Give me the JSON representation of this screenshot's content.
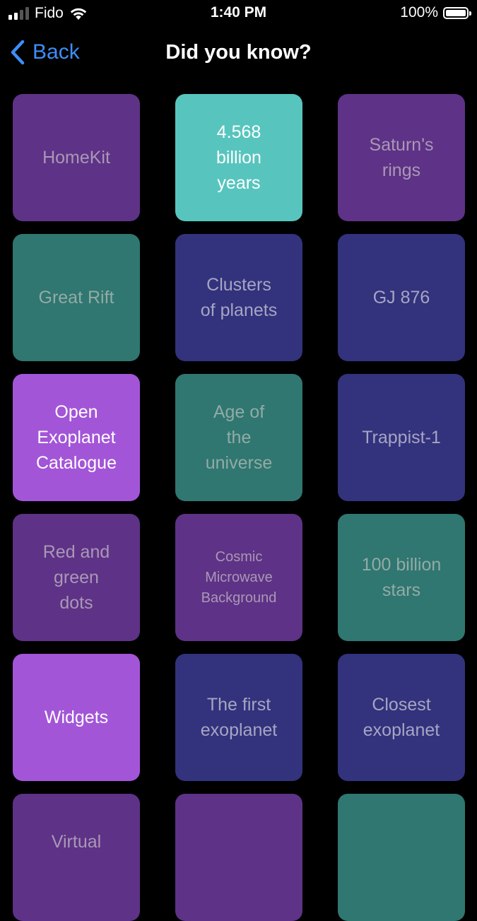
{
  "status_bar": {
    "carrier": "Fido",
    "time": "1:40 PM",
    "battery": "100%"
  },
  "nav": {
    "back_label": "Back",
    "title": "Did you know?"
  },
  "colors": {
    "accent_blue": "#3d8ef7",
    "purple": "#5e3286",
    "teal": "#2f7770",
    "navy": "#33327d",
    "aqua_selected": "#57c5be",
    "violet_selected": "#a355d8"
  },
  "tiles": [
    {
      "label": "HomeKit",
      "color": "purple"
    },
    {
      "label": "4.568\nbillion\nyears",
      "color": "aqua"
    },
    {
      "label": "Saturn's\nrings",
      "color": "purple"
    },
    {
      "label": "Great Rift",
      "color": "teal"
    },
    {
      "label": "Clusters\nof planets",
      "color": "navy"
    },
    {
      "label": "GJ 876",
      "color": "navy"
    },
    {
      "label": "Open\nExoplanet\nCatalogue",
      "color": "violet"
    },
    {
      "label": "Age of\nthe\nuniverse",
      "color": "teal"
    },
    {
      "label": "Trappist-1",
      "color": "navy"
    },
    {
      "label": "Red and\ngreen\ndots",
      "color": "purple"
    },
    {
      "label": "Cosmic\nMicrowave\nBackground",
      "color": "purple"
    },
    {
      "label": "100 billion\nstars",
      "color": "teal"
    },
    {
      "label": "Widgets",
      "color": "violet"
    },
    {
      "label": "The first\nexoplanet",
      "color": "navy"
    },
    {
      "label": "Closest\nexoplanet",
      "color": "navy"
    },
    {
      "label": "Virtual",
      "color": "purple"
    },
    {
      "label": "",
      "color": "purple"
    },
    {
      "label": "",
      "color": "teal"
    }
  ]
}
